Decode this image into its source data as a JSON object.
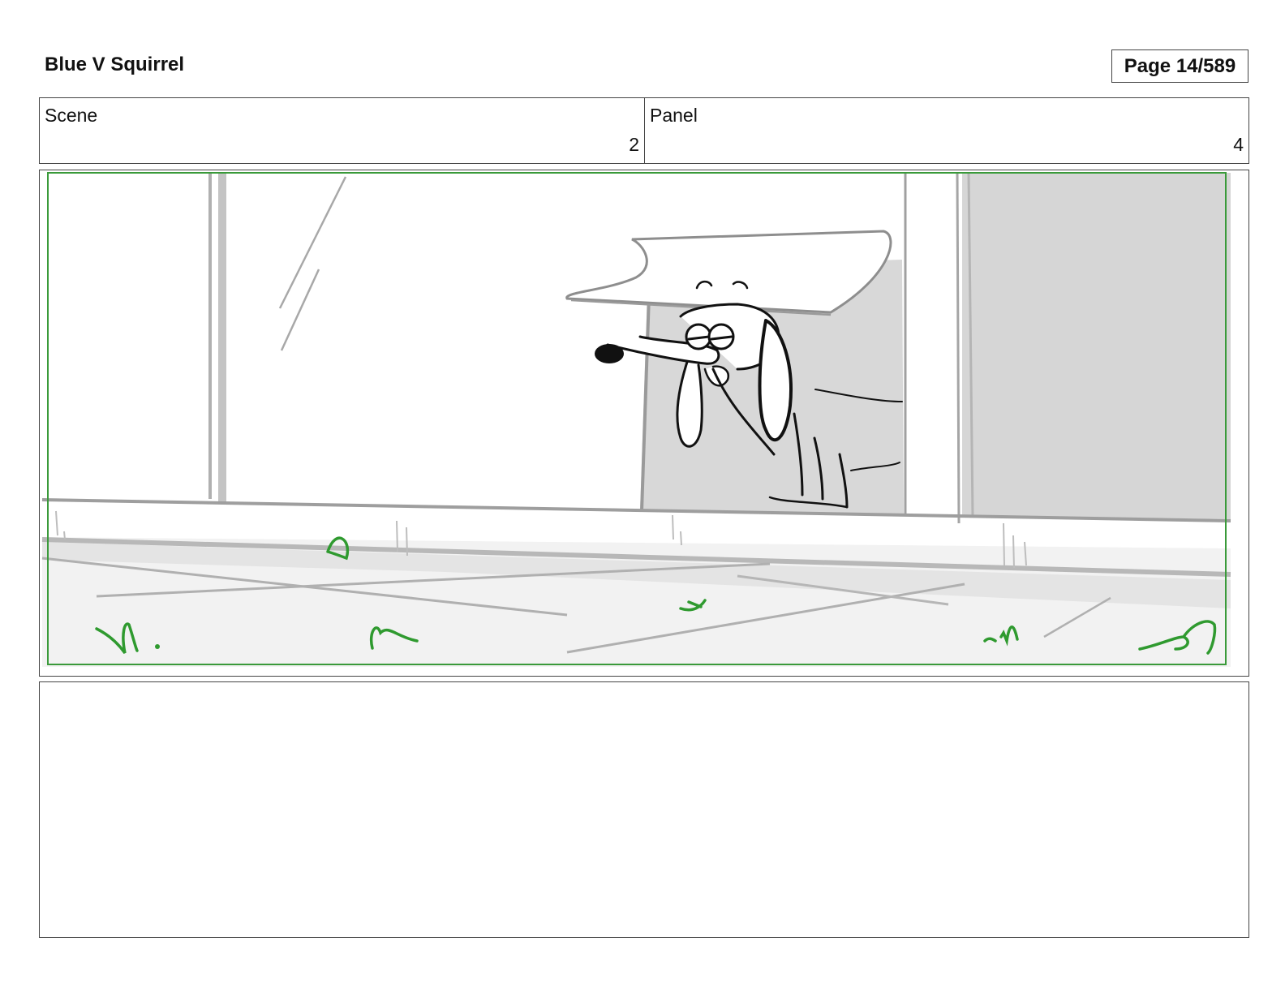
{
  "header": {
    "project_title": "Blue V Squirrel",
    "page_label": "Page",
    "page_number": "14/589"
  },
  "info": {
    "scene_label": "Scene",
    "scene_value": "2",
    "panel_label": "Panel",
    "panel_value": "4"
  },
  "colors": {
    "safe_frame": "#3a9a3a",
    "grass": "#2f9a2f",
    "sketch_gray": "#a8a8a8",
    "shadow_fill": "#d3d3d3",
    "ink": "#111111"
  }
}
